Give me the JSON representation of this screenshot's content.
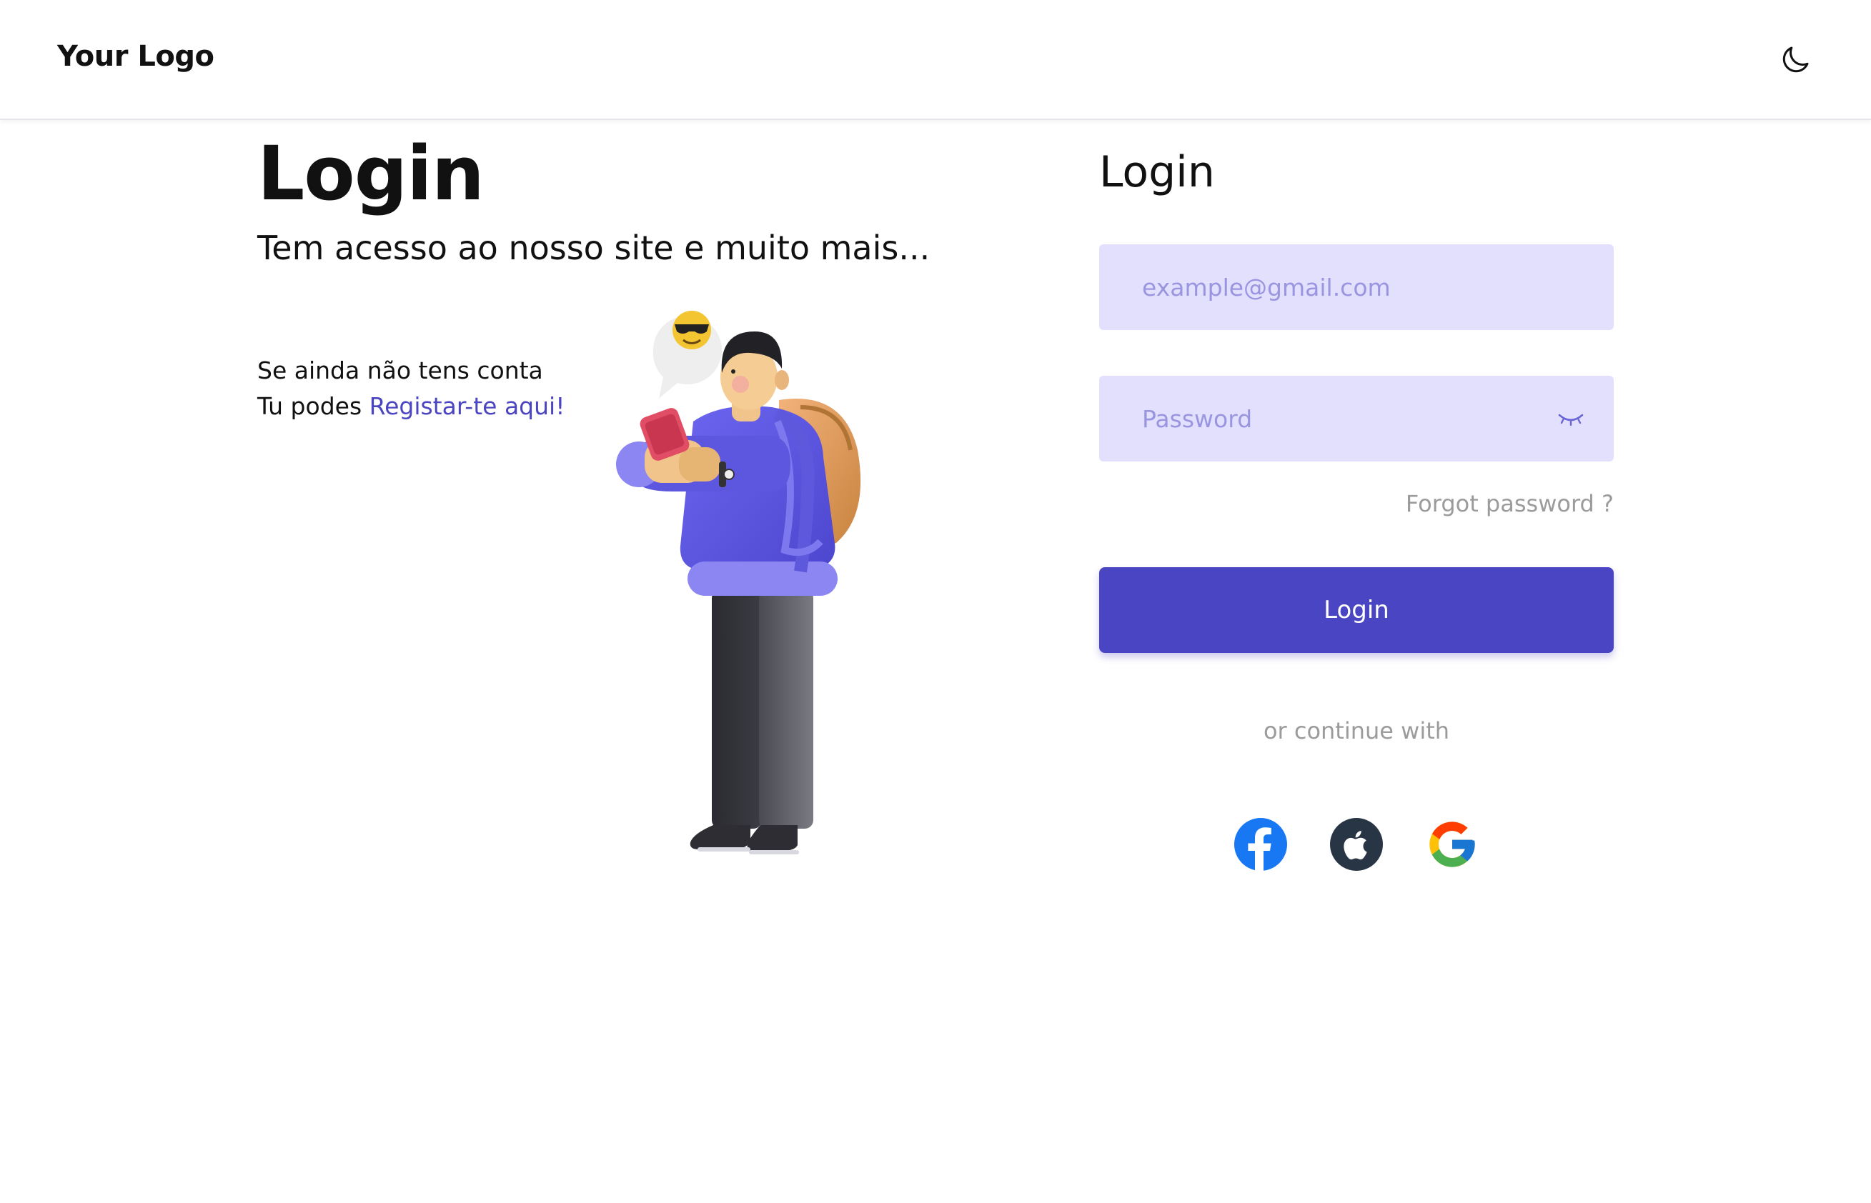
{
  "header": {
    "logo": "Your Logo",
    "theme_toggle_icon": "moon-icon"
  },
  "hero": {
    "title": "Login",
    "subtitle": "Tem acesso ao nosso site e muito mais...",
    "register_line1": "Se ainda não tens conta",
    "register_line2_prefix": "Tu podes ",
    "register_link": "Registar-te aqui!"
  },
  "form": {
    "title": "Login",
    "email_placeholder": "example@gmail.com",
    "password_placeholder": "Password",
    "password_toggle_icon": "eye-closed-icon",
    "forgot_label": "Forgot password ?",
    "submit_label": "Login",
    "divider_label": "or continue with",
    "social": [
      "facebook-icon",
      "apple-icon",
      "google-icon"
    ]
  },
  "colors": {
    "accent": "#4a46c3",
    "input_bg": "#e2e0fd",
    "placeholder": "#9a95e0",
    "muted_text": "#9b9b9b",
    "link": "#4b45c1"
  }
}
